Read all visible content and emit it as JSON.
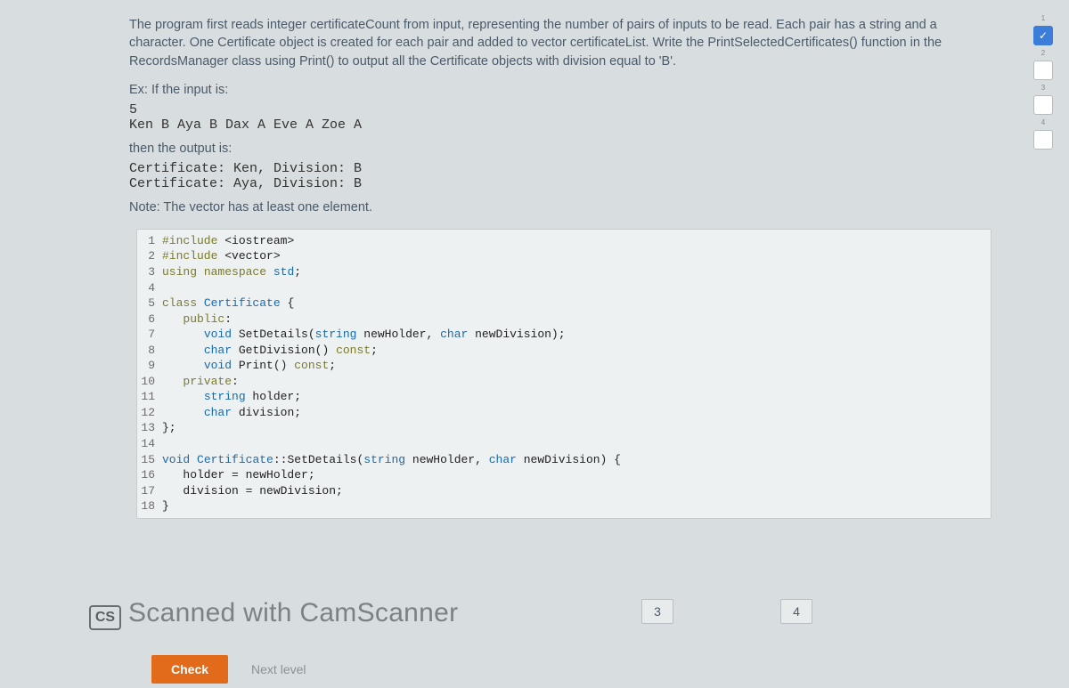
{
  "problem": {
    "description": "The program first reads integer certificateCount from input, representing the number of pairs of inputs to be read. Each pair has a string and a character. One Certificate object is created for each pair and added to vector certificateList. Write the PrintSelectedCertificates() function in the RecordsManager class using Print() to output all the Certificate objects with division equal to 'B'.",
    "example_label": "Ex: If the input is:",
    "example_input": "5\nKen B Aya B Dax A Eve A Zoe A",
    "then_label": "then the output is:",
    "example_output": "Certificate: Ken, Division: B\nCertificate: Aya, Division: B",
    "note": "Note: The vector has at least one element."
  },
  "code_lines": [
    {
      "n": "1",
      "html": "<span class='kw-pre'>#include</span> <span class='ident'>&lt;iostream&gt;</span>"
    },
    {
      "n": "2",
      "html": "<span class='kw-pre'>#include</span> <span class='ident'>&lt;vector&gt;</span>"
    },
    {
      "n": "3",
      "html": "<span class='kw-using'>using</span> <span class='kw-using'>namespace</span> <span class='kw-ns'>std</span>;"
    },
    {
      "n": "4",
      "html": ""
    },
    {
      "n": "5",
      "html": "<span class='kw-class'>class</span> <span class='kw-type'>Certificate</span> {"
    },
    {
      "n": "6",
      "html": "   <span class='kw-class'>public</span>:"
    },
    {
      "n": "7",
      "html": "      <span class='kw-type'>void</span> SetDetails(<span class='kw-type'>string</span> newHolder, <span class='kw-type'>char</span> newDivision);"
    },
    {
      "n": "8",
      "html": "      <span class='kw-type'>char</span> GetDivision() <span class='kw-const'>const</span>;"
    },
    {
      "n": "9",
      "html": "      <span class='kw-type'>void</span> Print() <span class='kw-const'>const</span>;"
    },
    {
      "n": "10",
      "html": "   <span class='kw-class'>private</span>:"
    },
    {
      "n": "11",
      "html": "      <span class='kw-type'>string</span> holder;"
    },
    {
      "n": "12",
      "html": "      <span class='kw-type'>char</span> division;"
    },
    {
      "n": "13",
      "html": "};"
    },
    {
      "n": "14",
      "html": ""
    },
    {
      "n": "15",
      "html": "<span class='kw-type'>void</span> <span class='kw-type'>Certificate</span>::SetDetails(<span class='kw-type'>string</span> newHolder, <span class='kw-type'>char</span> newDivision) {"
    },
    {
      "n": "16",
      "html": "   holder = newHolder;"
    },
    {
      "n": "17",
      "html": "   division = newDivision;"
    },
    {
      "n": "18",
      "html": "}"
    }
  ],
  "steps": [
    {
      "num": "1",
      "done": true,
      "glyph": "✓"
    },
    {
      "num": "2",
      "done": false,
      "glyph": ""
    },
    {
      "num": "3",
      "done": false,
      "glyph": ""
    },
    {
      "num": "4",
      "done": false,
      "glyph": ""
    }
  ],
  "step_nav": {
    "a": "3",
    "b": "4"
  },
  "watermark": {
    "badge": "CS",
    "text": "Scanned with CamScanner"
  },
  "actions": {
    "check": "Check",
    "next": "Next level"
  }
}
